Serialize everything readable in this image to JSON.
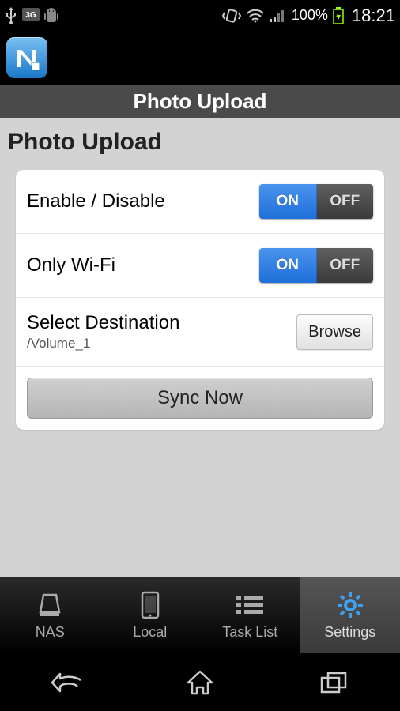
{
  "status": {
    "battery": "100%",
    "time": "18:21"
  },
  "titlebar": {
    "title": "Photo Upload"
  },
  "page": {
    "heading": "Photo Upload"
  },
  "rows": {
    "enable": {
      "label": "Enable / Disable",
      "on": "ON",
      "off": "OFF",
      "value": "ON"
    },
    "wifi": {
      "label": "Only Wi-Fi",
      "on": "ON",
      "off": "OFF",
      "value": "ON"
    },
    "dest": {
      "label": "Select Destination",
      "path": "/Volume_1",
      "browse": "Browse"
    },
    "sync": {
      "label": "Sync Now"
    }
  },
  "tabs": {
    "nas": {
      "label": "NAS"
    },
    "local": {
      "label": "Local"
    },
    "tasklist": {
      "label": "Task List"
    },
    "settings": {
      "label": "Settings"
    }
  }
}
